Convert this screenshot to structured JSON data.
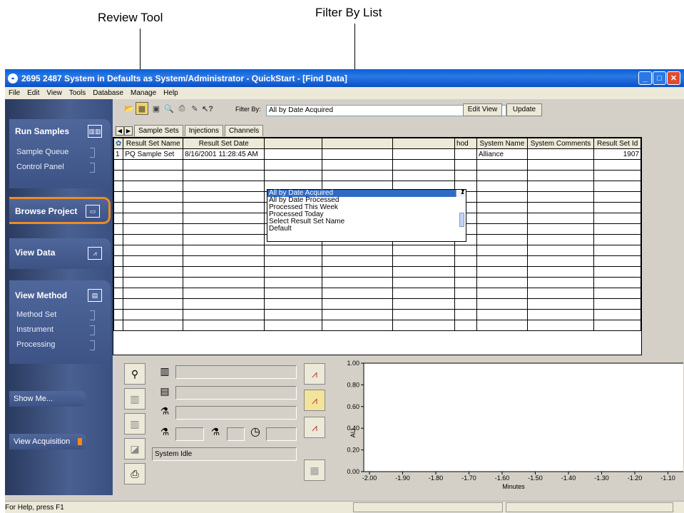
{
  "callouts": {
    "review_tool": "Review Tool",
    "filter_by_list": "Filter By List"
  },
  "window": {
    "title": "2695 2487 System in Defaults as System/Administrator - QuickStart - [Find Data]"
  },
  "menu": [
    "File",
    "Edit",
    "View",
    "Tools",
    "Database",
    "Manage",
    "Help"
  ],
  "sidebar": {
    "run_samples": {
      "label": "Run Samples",
      "items": [
        "Sample Queue",
        "Control Panel"
      ]
    },
    "browse_project": {
      "label": "Browse Project"
    },
    "view_data": {
      "label": "View Data"
    },
    "view_method": {
      "label": "View Method",
      "items": [
        "Method Set",
        "Instrument",
        "Processing"
      ]
    },
    "show_me": "Show Me...",
    "view_acquisition": "View Acquisition"
  },
  "toolbar": {
    "filter_label": "Filter By:",
    "filter_value": "All by Date Acquired",
    "edit_view": "Edit View",
    "update": "Update"
  },
  "dropdown_options": [
    "All by Date Acquired",
    "All by Date Processed",
    "Processed This Week",
    "Processed Today",
    "Select Result Set Name",
    "Default"
  ],
  "tabs": [
    "Sample Sets",
    "Injections",
    "Channels"
  ],
  "table": {
    "headers": [
      "",
      "Result Set Name",
      "Result Set Date",
      "",
      "",
      "",
      "hod",
      "System Name",
      "System Comments",
      "Result Set Id"
    ],
    "row1": [
      "1",
      "PQ Sample Set",
      "8/16/2001 11:28:45 AM",
      "",
      "",
      "",
      "",
      "Alliance",
      "",
      "1907"
    ]
  },
  "status_panel": {
    "system_status": "System Idle"
  },
  "chart_data": {
    "type": "line",
    "xlabel": "Minutes",
    "ylabel": "AU",
    "y_ticks": [
      "1.00",
      "0.80",
      "0.60",
      "0.40",
      "0.20",
      "0.00"
    ],
    "x_ticks": [
      "-2.00",
      "-1.90",
      "-1.80",
      "-1.70",
      "-1.60",
      "-1.50",
      "-1.40",
      "-1.30",
      "-1.20",
      "-1.10"
    ],
    "ylim": [
      0,
      1
    ],
    "xlim": [
      -2.0,
      -1.1
    ]
  },
  "statusbar": {
    "help": "For Help, press F1"
  }
}
